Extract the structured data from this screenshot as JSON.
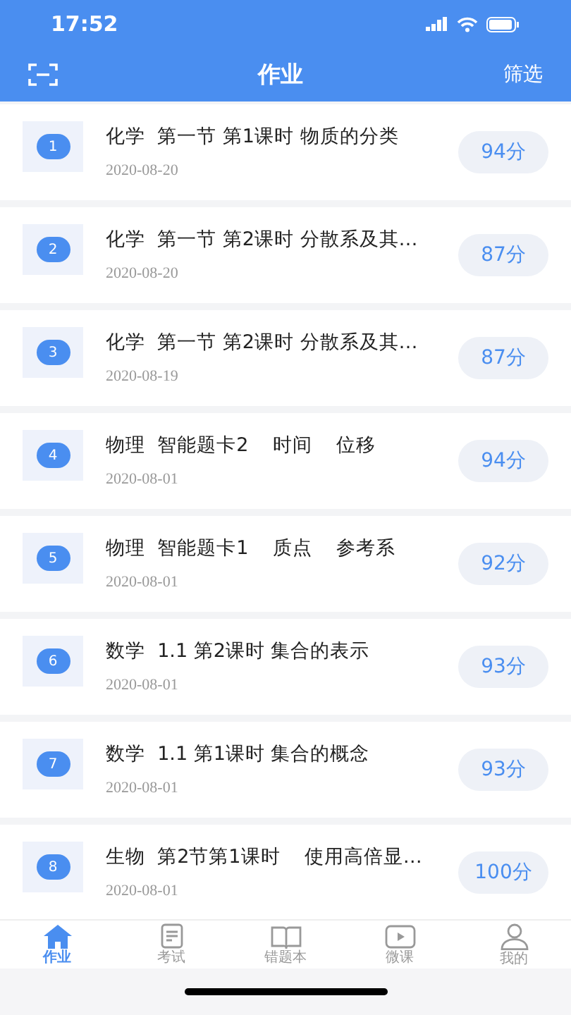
{
  "status_bar": {
    "time": "17:52"
  },
  "header": {
    "title": "作业",
    "action": "筛选"
  },
  "items": [
    {
      "number": "1",
      "title": "化学  第一节 第1课时 物质的分类",
      "date": "2020-08-20",
      "score": "94分"
    },
    {
      "number": "2",
      "title": "化学  第一节 第2课时 分散系及其…",
      "date": "2020-08-20",
      "score": "87分"
    },
    {
      "number": "3",
      "title": "化学  第一节 第2课时 分散系及其…",
      "date": "2020-08-19",
      "score": "87分"
    },
    {
      "number": "4",
      "title": "物理  智能题卡2    时间    位移",
      "date": "2020-08-01",
      "score": "94分"
    },
    {
      "number": "5",
      "title": "物理  智能题卡1    质点    参考系",
      "date": "2020-08-01",
      "score": "92分"
    },
    {
      "number": "6",
      "title": "数学  1.1 第2课时 集合的表示",
      "date": "2020-08-01",
      "score": "93分"
    },
    {
      "number": "7",
      "title": "数学  1.1 第1课时 集合的概念",
      "date": "2020-08-01",
      "score": "93分"
    },
    {
      "number": "8",
      "title": "生物  第2节第1课时    使用高倍显…",
      "date": "2020-08-01",
      "score": "100分"
    }
  ],
  "tabs": [
    {
      "label": "作业",
      "kind": "home",
      "selected": true
    },
    {
      "label": "考试",
      "kind": "exam",
      "selected": false
    },
    {
      "label": "错题本",
      "kind": "book",
      "selected": false
    },
    {
      "label": "微课",
      "kind": "video",
      "selected": false
    },
    {
      "label": "我的",
      "kind": "user",
      "selected": false
    }
  ]
}
